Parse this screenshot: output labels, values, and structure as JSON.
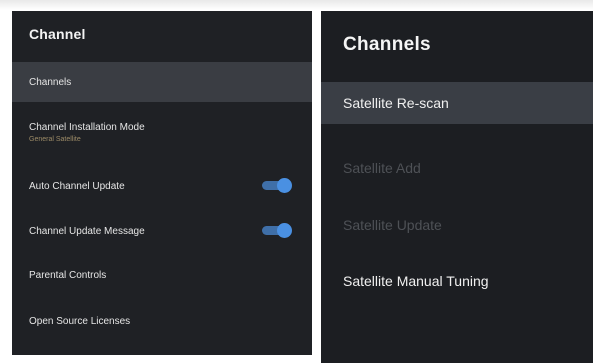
{
  "left_panel": {
    "title": "Channel",
    "items": [
      {
        "label": "Channels",
        "selected": true
      },
      {
        "label": "Channel Installation Mode",
        "sublabel": "General Satellite"
      },
      {
        "label": "Auto Channel Update",
        "toggle": "on"
      },
      {
        "label": "Channel Update Message",
        "toggle": "on"
      },
      {
        "label": "Parental Controls"
      },
      {
        "label": "Open Source Licenses"
      }
    ]
  },
  "right_panel": {
    "title": "Channels",
    "items": [
      {
        "label": "Satellite Re-scan",
        "selected": true,
        "enabled": true
      },
      {
        "label": "Satellite Add",
        "enabled": false
      },
      {
        "label": "Satellite Update",
        "enabled": false
      },
      {
        "label": "Satellite Manual Tuning",
        "enabled": true
      }
    ]
  },
  "colors": {
    "panel_background": "#1f2125",
    "selected_background": "#3a3d43",
    "toggle_accent": "#4a90e2",
    "disabled_text": "#4e5156"
  }
}
